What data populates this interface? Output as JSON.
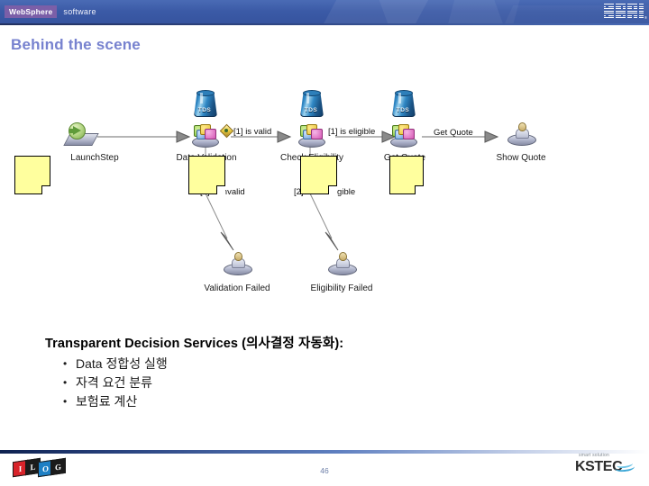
{
  "banner": {
    "product_badge": "WebSphere",
    "product_suffix": "software",
    "brand": "IBM",
    "brand_tm": "®"
  },
  "slide": {
    "title": "Behind the scene",
    "page_number": "46"
  },
  "diagram": {
    "nodes": [
      {
        "id": "launch",
        "label": "LaunchStep",
        "kind": "launch-step-icon"
      },
      {
        "id": "data-validation",
        "label": "Data Validation",
        "kind": "rule-decision-icon",
        "server": "TDS"
      },
      {
        "id": "check-eligibility",
        "label": "Check Eligibility",
        "kind": "rule-decision-icon",
        "server": "TDS"
      },
      {
        "id": "get-quote",
        "label": "Get Quote",
        "kind": "rule-decision-icon",
        "server": "TDS"
      },
      {
        "id": "show-quote",
        "label": "Show Quote",
        "kind": "actor-icon"
      },
      {
        "id": "validation-failed",
        "label": "Validation Failed",
        "kind": "actor-icon"
      },
      {
        "id": "eligibility-failed",
        "label": "Eligibility Failed",
        "kind": "actor-icon"
      }
    ],
    "flow_labels": [
      {
        "id": "is-valid",
        "text": "[1] is valid"
      },
      {
        "id": "is-invalid",
        "text": "[2] is invalid"
      },
      {
        "id": "is-eligible",
        "text": "[1] is eligible"
      },
      {
        "id": "is-not-eligible",
        "text": "[2] is not eligible"
      },
      {
        "id": "get-quote-flow",
        "text": "Get Quote"
      }
    ],
    "server_label": "TDS",
    "sticky_note_count": 4
  },
  "content": {
    "heading": "Transparent Decision Services (의사결정 자동화):",
    "bullets": [
      "Data 정합성 실행",
      "자격 요건 분류",
      "보험료 계산"
    ]
  },
  "footer": {
    "ilog": {
      "letters": [
        "I",
        "L",
        "O",
        "G"
      ]
    },
    "kstec": {
      "tagline": "smart solution",
      "name": "KSTEC"
    }
  },
  "colors": {
    "banner_blue": "#3b5aa6",
    "title_periwinkle": "#7782cf",
    "sticky_yellow": "#ffff9e",
    "websphere_purple": "#7b5fa8",
    "tds_blue": "#2f87c4"
  }
}
